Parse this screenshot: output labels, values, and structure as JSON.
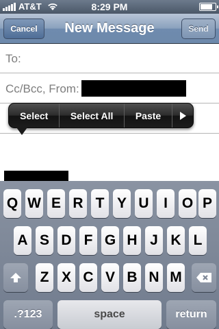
{
  "status_bar": {
    "carrier": "AT&T",
    "time": "8:29 PM",
    "battery_level": 0.9
  },
  "nav": {
    "title": "New Message",
    "cancel_label": "Cancel",
    "send_label": "Send"
  },
  "fields": {
    "to_label": "To:",
    "ccbcc_label": "Cc/Bcc, From:"
  },
  "edit_menu": {
    "select": "Select",
    "select_all": "Select All",
    "paste": "Paste"
  },
  "keyboard": {
    "row1": [
      "Q",
      "W",
      "E",
      "R",
      "T",
      "Y",
      "U",
      "I",
      "O",
      "P"
    ],
    "row2": [
      "A",
      "S",
      "D",
      "F",
      "G",
      "H",
      "J",
      "K",
      "L"
    ],
    "row3": [
      "Z",
      "X",
      "C",
      "V",
      "B",
      "N",
      "M"
    ],
    "numbers_label": ".?123",
    "space_label": "space",
    "return_label": "return"
  }
}
